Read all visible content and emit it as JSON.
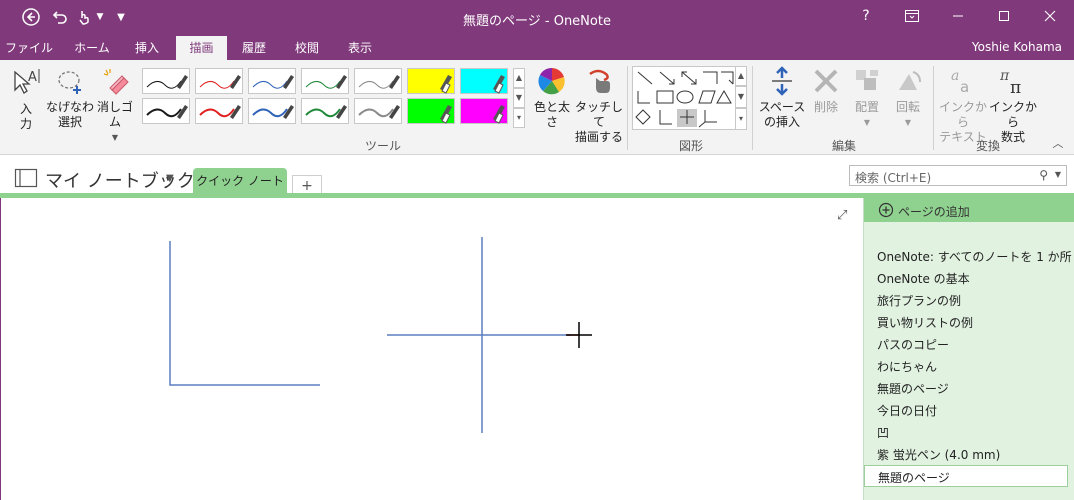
{
  "window": {
    "title": "無題のページ - OneNote",
    "help": "?",
    "controls": [
      "ribbon-display-options",
      "minimize",
      "maximize",
      "close"
    ]
  },
  "quick_access": {
    "icons": [
      "back-icon",
      "undo-icon",
      "touch-mode-icon",
      "dropdown-icon",
      "customize-icon"
    ]
  },
  "tabs": [
    "ファイル",
    "ホーム",
    "挿入",
    "描画",
    "履歴",
    "校閲",
    "表示"
  ],
  "active_tab": "描画",
  "user": "Yoshie Kohama",
  "ribbon": {
    "input_btn": "入力",
    "lasso_line1": "なげなわ",
    "lasso_line2": "選択",
    "eraser": "消しゴム",
    "color_thickness": "色と太さ",
    "touch_line1": "タッチして",
    "touch_line2": "描画する",
    "tools_label": "ツール",
    "shapes_label": "図形",
    "insert_space_line1": "スペース",
    "insert_space_line2": "の挿入",
    "delete": "削除",
    "arrange": "配置",
    "rotate": "回転",
    "edit_label": "編集",
    "ink_to_text_line1": "インクから",
    "ink_to_text_line2": "テキスト",
    "ink_to_math_line1": "インクから",
    "ink_to_math_line2": "数式",
    "convert_label": "変換",
    "pen_colors": [
      "#1a1a1a",
      "#e02020",
      "#2f63b8",
      "#1f8a3a",
      "#7a7a7a",
      "#ffff00",
      "#00ffff",
      "#1a1a1a",
      "#e02020",
      "#2f63b8",
      "#1f8a3a",
      "#7a7a7a",
      "#00ff00",
      "#ff00ff"
    ],
    "ink_shapes": [
      "line",
      "arrow",
      "double-arrow",
      "corner-right",
      "corner-left",
      "corner-down",
      "rectangle",
      "ellipse",
      "parallelogram",
      "triangle",
      "diamond",
      "axis-xy",
      "axis-xy-alt",
      "axis-3d"
    ]
  },
  "notebook": {
    "name": "マイ ノートブック",
    "section": "クイック ノート",
    "add_section": "+"
  },
  "search": {
    "placeholder": "検索 (Ctrl+E)"
  },
  "pages": {
    "add_page": "ページの追加",
    "items": [
      "OneNote: すべてのノートを 1 か所",
      "OneNote の基本",
      "旅行プランの例",
      "買い物リストの例",
      "パスのコピー",
      "わにちゃん",
      "無題のページ",
      "今日の日付",
      "凹",
      "紫 蛍光ペン (4.0 mm)"
    ],
    "selected": "無題のページ"
  },
  "colors": {
    "accent": "#80397B",
    "section_green": "#8FD18F",
    "page_pane": "#E1F2E1",
    "ink_line": "#5B7FC0"
  }
}
